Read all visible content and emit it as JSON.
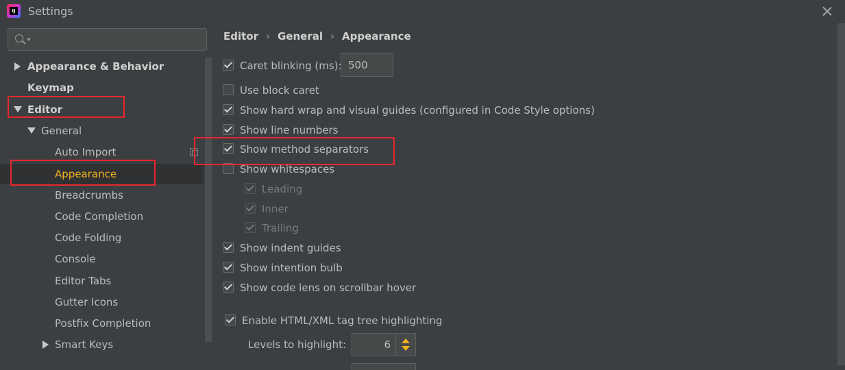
{
  "window": {
    "title": "Settings",
    "app_icon_text": "IJ"
  },
  "search": {
    "placeholder": ""
  },
  "sidebar": {
    "items": [
      {
        "label": "Appearance & Behavior"
      },
      {
        "label": "Keymap"
      },
      {
        "label": "Editor"
      },
      {
        "label": "General"
      },
      {
        "label": "Auto Import"
      },
      {
        "label": "Appearance"
      },
      {
        "label": "Breadcrumbs"
      },
      {
        "label": "Code Completion"
      },
      {
        "label": "Code Folding"
      },
      {
        "label": "Console"
      },
      {
        "label": "Editor Tabs"
      },
      {
        "label": "Gutter Icons"
      },
      {
        "label": "Postfix Completion"
      },
      {
        "label": "Smart Keys"
      }
    ]
  },
  "breadcrumb": {
    "items": [
      "Editor",
      "General",
      "Appearance"
    ],
    "separator": "›"
  },
  "options": {
    "caret_blinking": {
      "label": "Caret blinking (ms):",
      "checked": true,
      "value": "500"
    },
    "use_block_caret": {
      "label": "Use block caret",
      "checked": false
    },
    "hard_wrap": {
      "label": "Show hard wrap and visual guides (configured in Code Style options)",
      "checked": true
    },
    "line_numbers": {
      "label": "Show line numbers",
      "checked": true
    },
    "method_separators": {
      "label": "Show method separators",
      "checked": true
    },
    "whitespaces": {
      "label": "Show whitespaces",
      "checked": false
    },
    "leading": {
      "label": "Leading",
      "checked": true,
      "enabled": false
    },
    "inner": {
      "label": "Inner",
      "checked": true,
      "enabled": false
    },
    "trailing": {
      "label": "Trailing",
      "checked": true,
      "enabled": false
    },
    "indent_guides": {
      "label": "Show indent guides",
      "checked": true
    },
    "intention_bulb": {
      "label": "Show intention bulb",
      "checked": true
    },
    "code_lens": {
      "label": "Show code lens on scrollbar hover",
      "checked": true
    },
    "tag_tree": {
      "label": "Enable HTML/XML tag tree highlighting",
      "checked": true
    },
    "levels": {
      "label": "Levels to highlight:",
      "value": "6"
    }
  },
  "colors": {
    "background": "#3c3f41",
    "selected_text": "#f0b31c",
    "highlight_box": "#e8262e"
  }
}
